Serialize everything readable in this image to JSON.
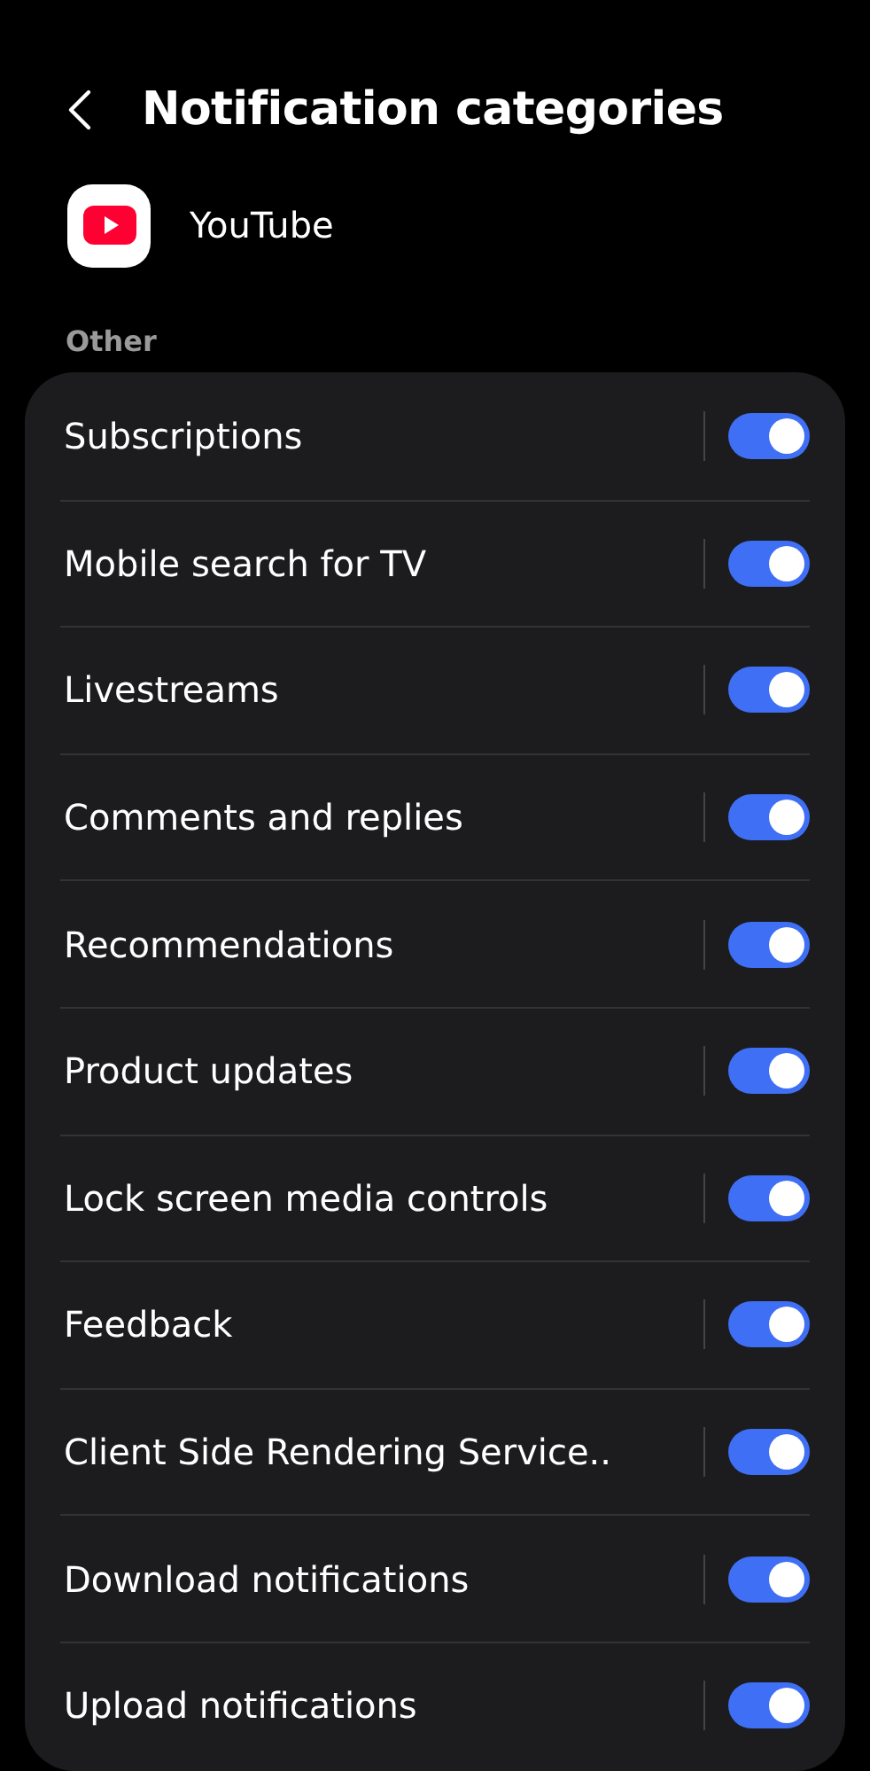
{
  "header": {
    "title": "Notification categories"
  },
  "app": {
    "name": "YouTube"
  },
  "section": {
    "label": "Other"
  },
  "categories": [
    {
      "label": "Subscriptions",
      "on": true
    },
    {
      "label": "Mobile search for TV",
      "on": true
    },
    {
      "label": "Livestreams",
      "on": true
    },
    {
      "label": "Comments and replies",
      "on": true
    },
    {
      "label": "Recommendations",
      "on": true
    },
    {
      "label": "Product updates",
      "on": true
    },
    {
      "label": "Lock screen media controls",
      "on": true
    },
    {
      "label": "Feedback",
      "on": true
    },
    {
      "label": "Client Side Rendering Service..",
      "on": true
    },
    {
      "label": "Download notifications",
      "on": true
    },
    {
      "label": "Upload notifications",
      "on": true
    }
  ]
}
